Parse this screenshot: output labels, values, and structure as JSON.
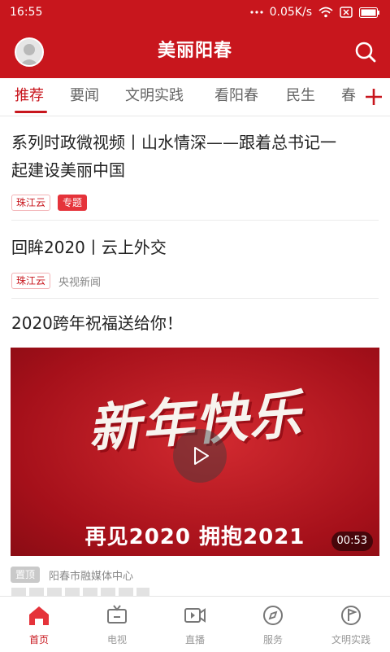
{
  "status_bar": {
    "time": "16:55",
    "speed": "0.05K/s"
  },
  "header": {
    "title": "美丽阳春"
  },
  "tabs": [
    {
      "label": "推荐",
      "active": true
    },
    {
      "label": "要闻"
    },
    {
      "label": "文明实践"
    },
    {
      "label": "看阳春"
    },
    {
      "label": "民生"
    },
    {
      "label": "春"
    }
  ],
  "articles": [
    {
      "headline_line1": "系列时政微视频丨山水情深——跟着总书记一",
      "headline_line2": "起建设美丽中国",
      "tags": [
        "珠江云",
        "专题"
      ]
    },
    {
      "headline": "回眸2020丨云上外交",
      "tag": "珠江云",
      "source": "央视新闻"
    },
    {
      "headline": "2020跨年祝福送给你！",
      "video_title": "新年快乐",
      "video_subtitle": "再见2020  拥抱2021",
      "duration": "00:53",
      "tag": "置顶",
      "source": "阳春市融媒体中心"
    }
  ],
  "bottom_nav": [
    {
      "label": "首页",
      "icon": "home-icon",
      "active": true
    },
    {
      "label": "电视",
      "icon": "tv-icon"
    },
    {
      "label": "直播",
      "icon": "live-camera-icon"
    },
    {
      "label": "服务",
      "icon": "compass-icon"
    },
    {
      "label": "文明实践",
      "icon": "flag-icon"
    }
  ],
  "colors": {
    "brand_red": "#c8161d",
    "inactive_gray": "#999999"
  }
}
